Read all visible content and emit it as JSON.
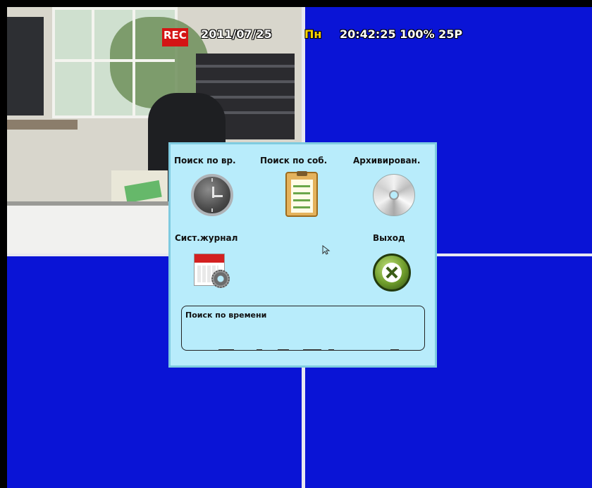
{
  "osd": {
    "rec": "REC",
    "date": "2011/07/25",
    "day": "Пн",
    "time": "20:42:25  100%  25P"
  },
  "menu": {
    "items": [
      {
        "label": "Поиск по вр.",
        "icon": "clock-icon"
      },
      {
        "label": "Поиск по соб.",
        "icon": "clipboard-checklist-icon"
      },
      {
        "label": "Архивирован.",
        "icon": "disc-icon"
      },
      {
        "label": "Сист.журнал",
        "icon": "calendar-gear-icon"
      },
      {
        "label": "Выход",
        "icon": "exit-icon"
      }
    ],
    "description": "Поиск по времени"
  },
  "colors": {
    "channel_bg": "#0a14d6",
    "menu_bg": "#b8ecfb",
    "rec": "#d41414",
    "day": "#ffd400"
  }
}
